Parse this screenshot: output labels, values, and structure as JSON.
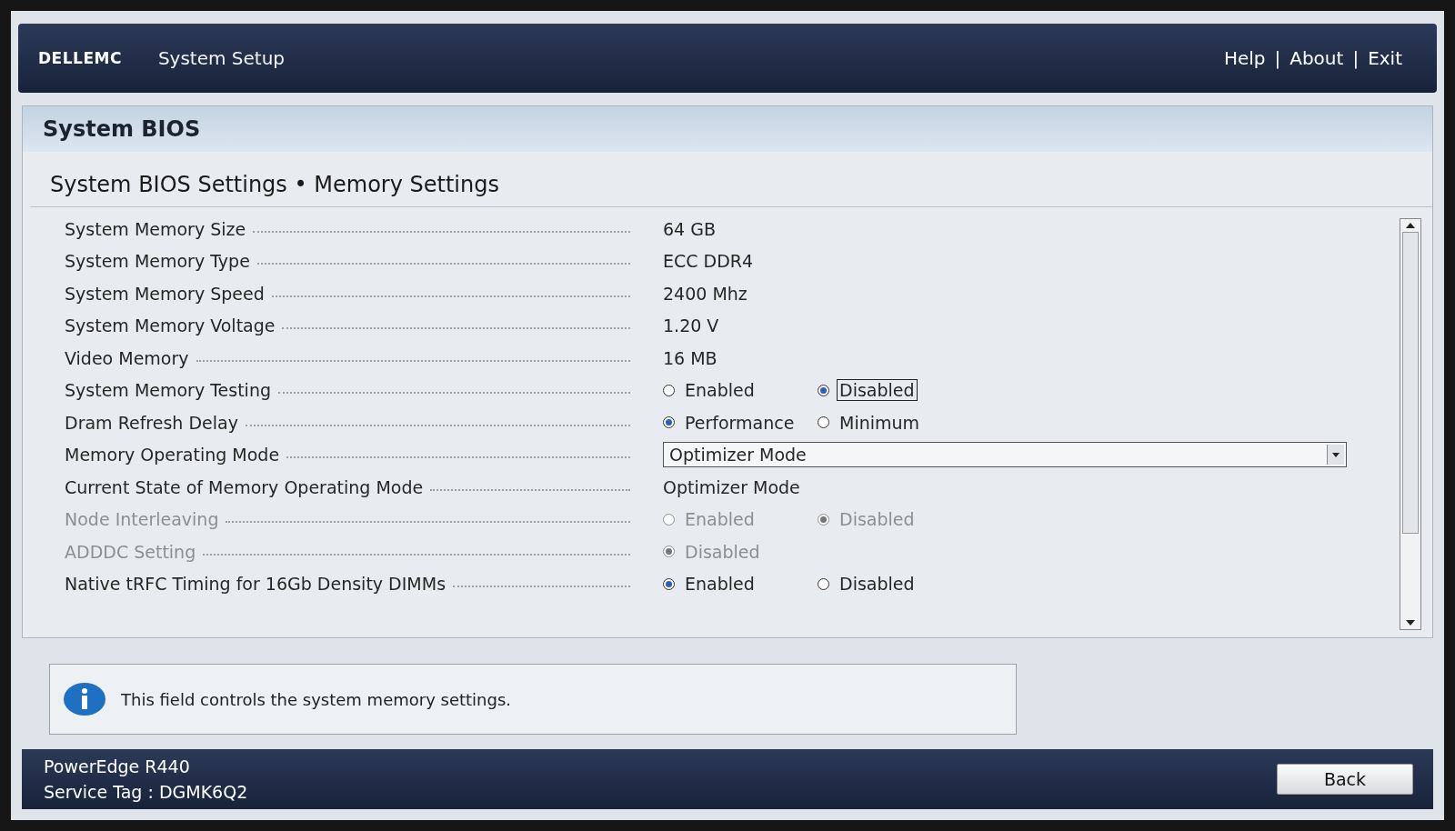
{
  "header": {
    "logo": "DELLEMC",
    "title": "System Setup",
    "links": [
      {
        "label": "Help"
      },
      {
        "label": "About"
      },
      {
        "label": "Exit"
      }
    ],
    "separator": "|"
  },
  "panel": {
    "title": "System BIOS",
    "subtitle": "System BIOS Settings • Memory Settings"
  },
  "rows": [
    {
      "kind": "value",
      "label": "System Memory Size",
      "value": "64 GB",
      "disabled": false
    },
    {
      "kind": "value",
      "label": "System Memory Type",
      "value": "ECC DDR4",
      "disabled": false
    },
    {
      "kind": "value",
      "label": "System Memory Speed",
      "value": "2400 Mhz",
      "disabled": false
    },
    {
      "kind": "value",
      "label": "System Memory Voltage",
      "value": "1.20 V",
      "disabled": false
    },
    {
      "kind": "value",
      "label": "Video Memory",
      "value": "16 MB",
      "disabled": false
    },
    {
      "kind": "radio",
      "label": "System Memory Testing",
      "disabled": false,
      "options": [
        {
          "label": "Enabled",
          "selected": false,
          "focused": false
        },
        {
          "label": "Disabled",
          "selected": true,
          "focused": true
        }
      ]
    },
    {
      "kind": "radio",
      "label": "Dram Refresh Delay",
      "disabled": false,
      "options": [
        {
          "label": "Performance",
          "selected": true,
          "focused": false
        },
        {
          "label": "Minimum",
          "selected": false,
          "focused": false
        }
      ]
    },
    {
      "kind": "dropdown",
      "label": "Memory Operating Mode",
      "value": "Optimizer Mode",
      "disabled": false
    },
    {
      "kind": "value",
      "label": "Current State of Memory Operating Mode",
      "value": "Optimizer Mode",
      "disabled": false
    },
    {
      "kind": "radio",
      "label": "Node Interleaving",
      "disabled": true,
      "options": [
        {
          "label": "Enabled",
          "selected": false,
          "focused": false
        },
        {
          "label": "Disabled",
          "selected": true,
          "focused": false
        }
      ]
    },
    {
      "kind": "radio",
      "label": "ADDDC Setting",
      "disabled": true,
      "options": [
        {
          "label": "Disabled",
          "selected": true,
          "focused": false
        }
      ]
    },
    {
      "kind": "radio",
      "label": "Native tRFC Timing for 16Gb Density DIMMs",
      "disabled": false,
      "options": [
        {
          "label": "Enabled",
          "selected": true,
          "focused": false
        },
        {
          "label": "Disabled",
          "selected": false,
          "focused": false
        }
      ]
    }
  ],
  "info": {
    "text": "This field controls the system memory settings."
  },
  "footer": {
    "model": "PowerEdge R440",
    "service_tag": "Service Tag : DGMK6Q2",
    "button": "Back"
  }
}
